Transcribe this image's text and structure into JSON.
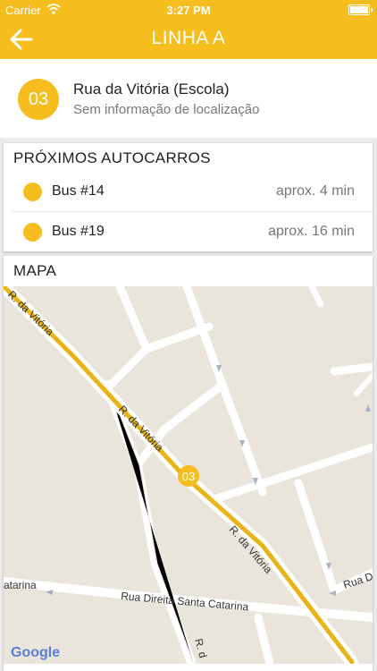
{
  "status_bar": {
    "carrier": "Carrier",
    "time": "3:27 PM"
  },
  "nav": {
    "title": "LINHA A"
  },
  "stop": {
    "number": "03",
    "name": "Rua da Vitória (Escola)",
    "subtitle": "Sem informação de localização"
  },
  "next_buses": {
    "title": "PRÓXIMOS AUTOCARROS",
    "items": [
      {
        "name": "Bus #14",
        "eta": "aprox. 4 min"
      },
      {
        "name": "Bus #19",
        "eta": "aprox. 16 min"
      }
    ]
  },
  "map": {
    "title": "MAPA",
    "marker_label": "03",
    "street_labels": {
      "r_vitoria_top": "R. da Vitória",
      "r_vitoria_mid": "R. da Vitória",
      "r_vitoria_low": "R. da Vitória",
      "catarina_left": "atarina",
      "direita_santa_catarina": "Rua Direita Santa Catarina",
      "rua_d": "Rua D",
      "r_d_bottom": "R. d"
    },
    "google_logo": "Google"
  },
  "colors": {
    "accent": "#f5bd1d",
    "route": "#e8b417"
  }
}
